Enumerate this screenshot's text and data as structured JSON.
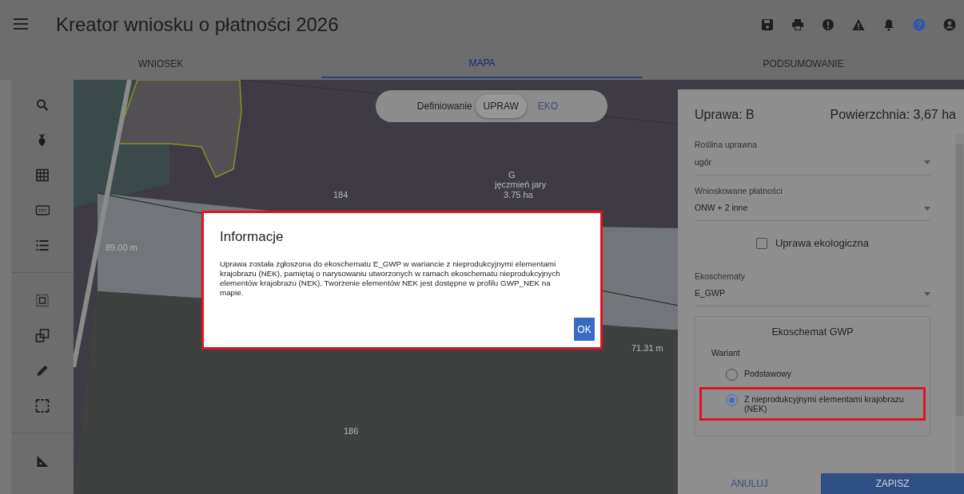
{
  "header": {
    "title": "Kreator wniosku o płatności 2026"
  },
  "tabs": [
    {
      "label": "WNIOSEK",
      "selected": false
    },
    {
      "label": "MAPA",
      "selected": true
    },
    {
      "label": "PODSUMOWANIE",
      "selected": false
    }
  ],
  "map": {
    "mode_toggle": {
      "label": "Definiowanie",
      "options": [
        {
          "label": "UPRAW",
          "selected": true
        },
        {
          "label": "EKO",
          "selected": false
        }
      ]
    },
    "labels": [
      {
        "text": "G"
      },
      {
        "text": "jęczmień jary"
      },
      {
        "text": "3.75 ha"
      },
      {
        "text": "184"
      },
      {
        "text": "89.00 m"
      },
      {
        "text": "71.31 m"
      },
      {
        "text": "186"
      }
    ]
  },
  "dialog": {
    "title": "Informacje",
    "message": "Uprawa została zgłoszona do ekoschematu E_GWP w wariancie z nieprodukcyjnymi elementami krajobrazu (NEK), pamiętaj o narysowaniu utworzonych w ramach ekoschematu nieprodukcyjnych elementów krajobrazu (NEK). Tworzenie elementów NEK jest dostępne w profilu GWP_NEK na mapie.",
    "button": "OK",
    "highlighted": true
  },
  "panel": {
    "crop": "Uprawa: B",
    "area": "Powierzchnia: 3,67 ha",
    "items": [
      {
        "kind": "select",
        "label": "Roślina uprawna",
        "value": "ugór"
      },
      {
        "kind": "select",
        "label": "Wnioskowane płatności",
        "value": "ONW + 2 inne"
      },
      {
        "kind": "checkbox",
        "label": "Uprawa ekologiczna",
        "checked": false
      },
      {
        "kind": "select",
        "label": "Ekoschematy",
        "value": "E_GWP"
      }
    ],
    "scheme": {
      "title": "Ekoschemat GWP",
      "group_label": "Wariant",
      "options": [
        {
          "label": "Podstawowy",
          "selected": false
        },
        {
          "label": "Z nieprodukcyjnymi elementami krajobrazu (NEK)",
          "selected": true,
          "highlighted": true
        }
      ]
    },
    "buttons": [
      {
        "label": "ANULUJ",
        "kind": "text"
      },
      {
        "label": "ZAPISZ",
        "kind": "primary"
      }
    ]
  }
}
